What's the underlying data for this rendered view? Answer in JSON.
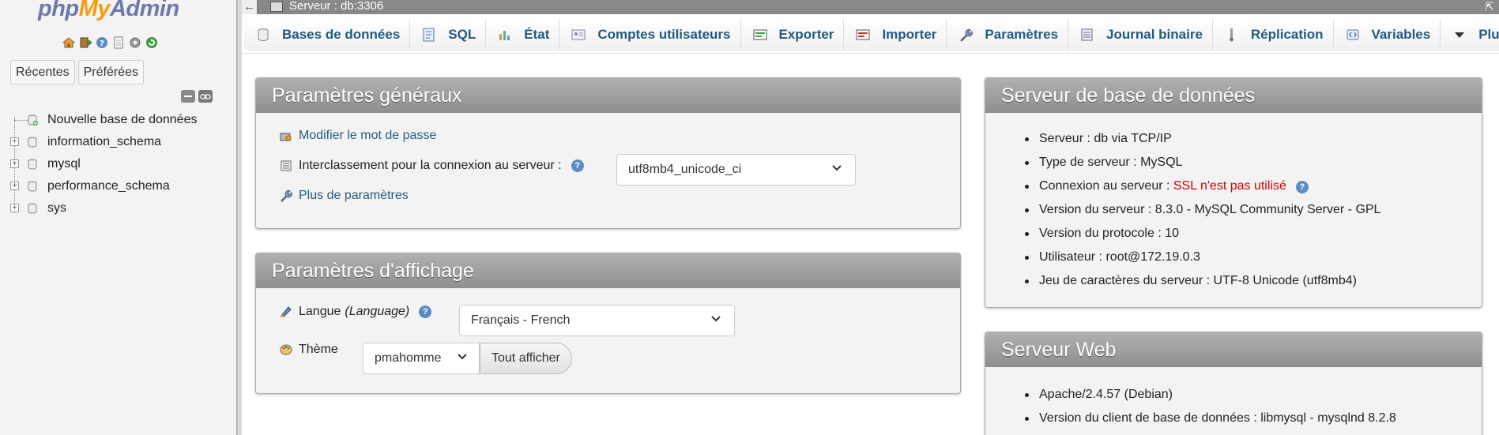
{
  "nav": {
    "logo": {
      "php": "php",
      "my": "My",
      "admin": "Admin"
    },
    "icons": [
      "home-icon",
      "exit-icon",
      "help-icon",
      "docs-icon",
      "settings-icon",
      "reload-icon"
    ],
    "tabs": [
      {
        "label": "Récentes"
      },
      {
        "label": "Préférées"
      }
    ],
    "tree": [
      {
        "label": "Nouvelle base de données",
        "expandable": false
      },
      {
        "label": "information_schema",
        "expandable": true
      },
      {
        "label": "mysql",
        "expandable": true
      },
      {
        "label": "performance_schema",
        "expandable": true
      },
      {
        "label": "sys",
        "expandable": true
      }
    ]
  },
  "topbar": {
    "back": "←",
    "server": "Serveur : db:3306"
  },
  "menu": [
    {
      "label": "Bases de données",
      "icon": "database-icon"
    },
    {
      "label": "SQL",
      "icon": "sql-icon"
    },
    {
      "label": "État",
      "icon": "status-icon"
    },
    {
      "label": "Comptes utilisateurs",
      "icon": "users-icon"
    },
    {
      "label": "Exporter",
      "icon": "export-icon"
    },
    {
      "label": "Importer",
      "icon": "import-icon"
    },
    {
      "label": "Paramètres",
      "icon": "wrench-icon"
    },
    {
      "label": "Journal binaire",
      "icon": "binlog-icon"
    },
    {
      "label": "Réplication",
      "icon": "replication-icon"
    },
    {
      "label": "Variables",
      "icon": "variables-icon"
    },
    {
      "label": "Plus",
      "icon": "triangle-down-icon"
    }
  ],
  "general": {
    "title": "Paramètres généraux",
    "change_password": "Modifier le mot de passe",
    "collation_label": "Interclassement pour la connexion au serveur :",
    "collation_value": "utf8mb4_unicode_ci",
    "more_settings": "Plus de paramètres"
  },
  "display": {
    "title": "Paramètres d'affichage",
    "language_label": "Langue",
    "language_label_en": "(Language)",
    "language_value": "Français - French",
    "theme_label": "Thème",
    "theme_value": "pmahomme",
    "view_all": "Tout afficher"
  },
  "db_server": {
    "title": "Serveur de base de données",
    "items": [
      {
        "label": "Serveur : db via TCP/IP"
      },
      {
        "label": "Type de serveur : MySQL"
      },
      {
        "label": "Connexion au serveur : ",
        "value": "SSL n'est pas utilisé",
        "value_color": "#cc0000"
      },
      {
        "label": "Version du serveur : 8.3.0 - MySQL Community Server - GPL"
      },
      {
        "label": "Version du protocole : 10"
      },
      {
        "label": "Utilisateur : root@172.19.0.3"
      },
      {
        "label": "Jeu de caractères du serveur : UTF-8 Unicode (utf8mb4)"
      }
    ]
  },
  "web_server": {
    "title": "Serveur Web",
    "items": [
      {
        "label": "Apache/2.4.57 (Debian)"
      },
      {
        "label": "Version du client de base de données : libmysql - mysqlnd 8.2.8"
      }
    ]
  }
}
